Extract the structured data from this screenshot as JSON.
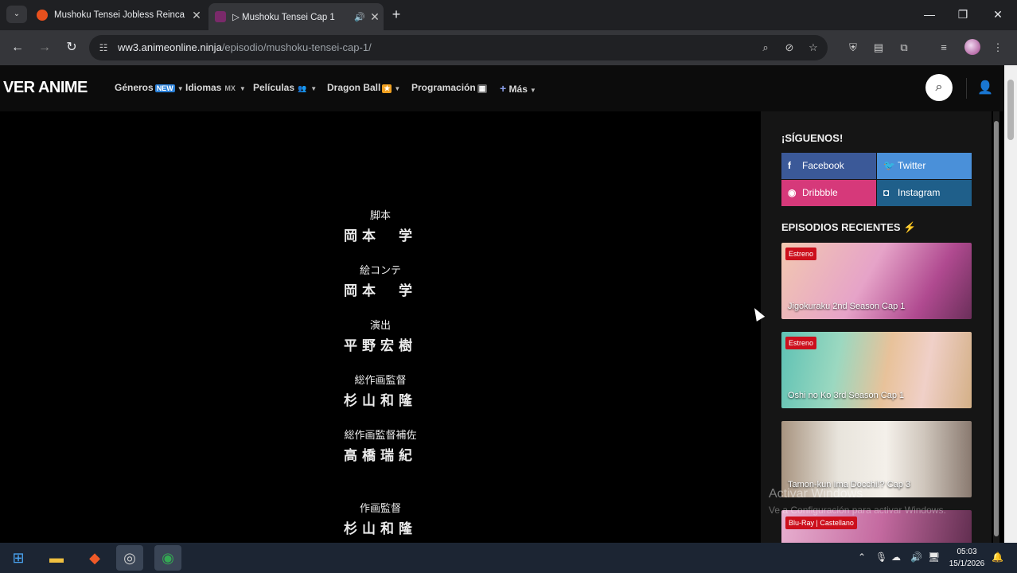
{
  "tabs": [
    {
      "title": "Mushoku Tensei Jobless Reinca",
      "favicon_color": "#e8501d",
      "active": false
    },
    {
      "title": "▷ Mushoku Tensei Cap 1",
      "favicon_color": "#7a2a6a",
      "active": true
    }
  ],
  "url": {
    "domain": "ww3.animeonline.ninja",
    "path": "/episodio/mushoku-tensei-cap-1/"
  },
  "site": {
    "logo": "VER ANIME",
    "nav": [
      {
        "label": "Géneros",
        "emoji": "🆕"
      },
      {
        "label": "Idiomas",
        "emoji": "MX"
      },
      {
        "label": "Películas",
        "emoji": "👥"
      },
      {
        "label": "Dragon Ball",
        "emoji": "🔶"
      },
      {
        "label": "Programación",
        "emoji": "📅"
      },
      {
        "label": "Más",
        "emoji": "+"
      }
    ]
  },
  "credits": [
    {
      "role": "脚本",
      "name": "岡本　学"
    },
    {
      "role": "絵コンテ",
      "name": "岡本　学"
    },
    {
      "role": "演出",
      "name": "平野宏樹"
    },
    {
      "role": "総作画監督",
      "name": "杉山和隆"
    },
    {
      "role": "総作画監督補佐",
      "name": "高橋瑞紀"
    },
    {
      "role": "作画監督",
      "name": "杉山和隆"
    }
  ],
  "sidebar": {
    "follow_title": "¡SÍGUENOS!",
    "social": [
      {
        "label": "Facebook",
        "icon": "f",
        "color": "#3b5998"
      },
      {
        "label": "Twitter",
        "icon": "🐦",
        "color": "#4a90d9"
      },
      {
        "label": "Dribbble",
        "icon": "◉",
        "color": "#d6397a"
      },
      {
        "label": "Instagram",
        "icon": "◘",
        "color": "#1f5f8a"
      }
    ],
    "recent_title": "EPISODIOS RECIENTES",
    "episodes": [
      {
        "title": "Jigokuraku 2nd Season Cap 1",
        "badge": "Estreno",
        "bg1": "#e6a3c8",
        "bg2": "#6b2f5a"
      },
      {
        "title": "Oshi no Ko 3rd Season Cap 1",
        "badge": "Estreno",
        "bg1": "#5fc2b4",
        "bg2": "#d4b087"
      },
      {
        "title": "Tamon-kun Ima Docchi!? Cap 3",
        "badge": "",
        "bg1": "#e8e4dc",
        "bg2": "#8a7a70"
      },
      {
        "title": "",
        "badge": "Blu-Ray | Castellano",
        "bg1": "#c46aa0",
        "bg2": "#5a2a4a"
      }
    ]
  },
  "watermark": {
    "line1": "Activar Windows",
    "line2": "Ve a Configuración para activar Windows."
  },
  "taskbar": {
    "time": "05:03",
    "date": "15/1/2026"
  }
}
